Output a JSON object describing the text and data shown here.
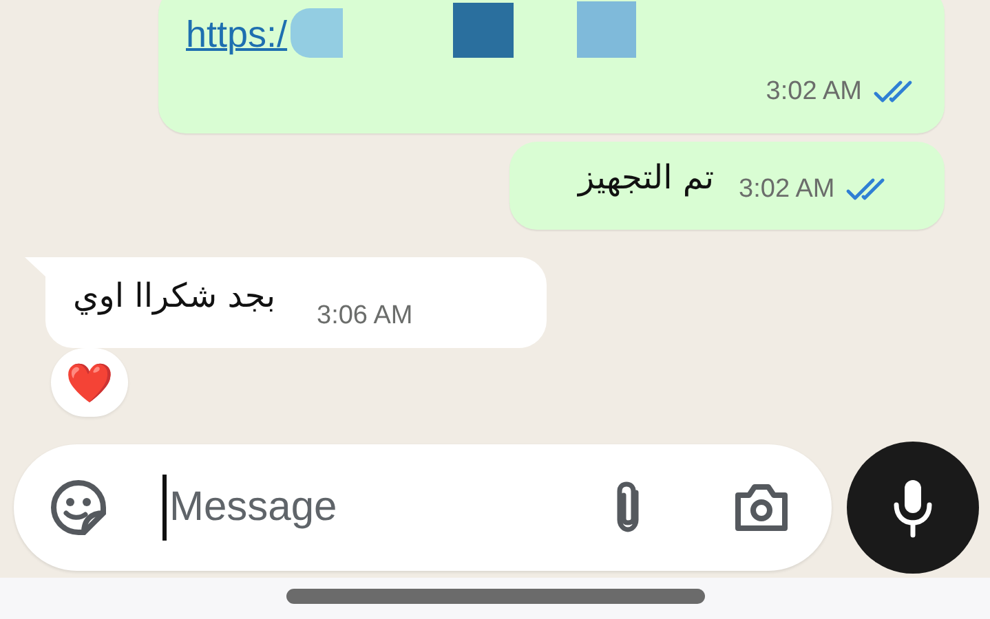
{
  "messages": [
    {
      "kind": "link",
      "outgoing": true,
      "text": "https:/",
      "time": "3:02 AM",
      "read": true
    },
    {
      "kind": "text",
      "outgoing": true,
      "text": "تم التجهيز",
      "time": "3:02 AM",
      "read": true
    },
    {
      "kind": "text",
      "outgoing": false,
      "text": "بجد شكراا اوي",
      "time": "3:06 AM",
      "reaction": "❤️"
    }
  ],
  "composer": {
    "placeholder": "Message"
  }
}
